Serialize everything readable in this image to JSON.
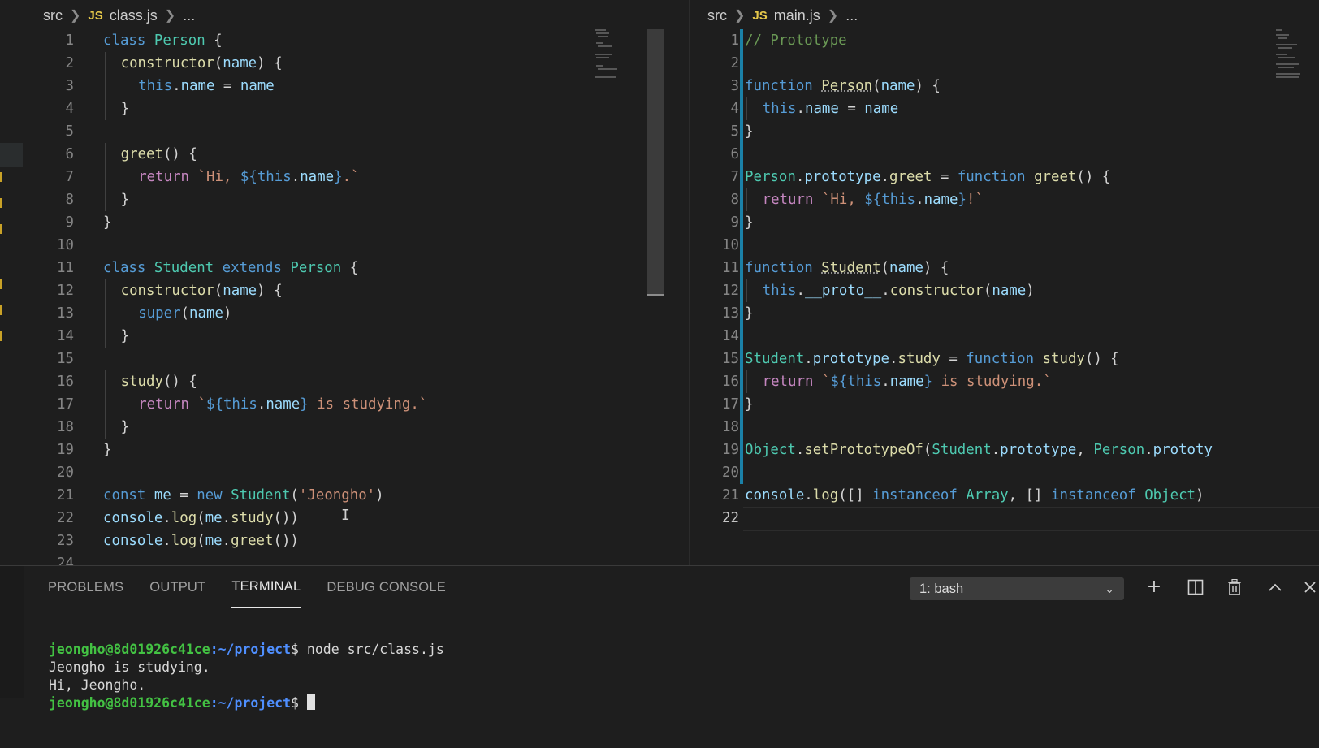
{
  "left_editor": {
    "breadcrumb": {
      "folder": "src",
      "lang_badge": "JS",
      "file": "class.js",
      "rest": "..."
    },
    "lines": [
      {
        "n": "1",
        "tokens": [
          [
            "k",
            "class"
          ],
          [
            "p",
            " "
          ],
          [
            "t",
            "Person"
          ],
          [
            "p",
            " {"
          ]
        ]
      },
      {
        "n": "2",
        "indent": 1,
        "tokens": [
          [
            "f",
            "constructor"
          ],
          [
            "p",
            "("
          ],
          [
            "v",
            "name"
          ],
          [
            "p",
            ") {"
          ]
        ]
      },
      {
        "n": "3",
        "indent": 2,
        "tokens": [
          [
            "k",
            "this"
          ],
          [
            "p",
            "."
          ],
          [
            "v",
            "name"
          ],
          [
            "p",
            " = "
          ],
          [
            "v",
            "name"
          ]
        ]
      },
      {
        "n": "4",
        "indent": 1,
        "tokens": [
          [
            "p",
            "}"
          ]
        ]
      },
      {
        "n": "5",
        "tokens": []
      },
      {
        "n": "6",
        "indent": 1,
        "tokens": [
          [
            "f",
            "greet"
          ],
          [
            "p",
            "() {"
          ]
        ]
      },
      {
        "n": "7",
        "indent": 2,
        "tokens": [
          [
            "kc",
            "return"
          ],
          [
            "p",
            " "
          ],
          [
            "s",
            "`Hi, "
          ],
          [
            "k",
            "${"
          ],
          [
            "k",
            "this"
          ],
          [
            "p",
            "."
          ],
          [
            "v",
            "name"
          ],
          [
            "k",
            "}"
          ],
          [
            "s",
            ".`"
          ]
        ]
      },
      {
        "n": "8",
        "indent": 1,
        "tokens": [
          [
            "p",
            "}"
          ]
        ]
      },
      {
        "n": "9",
        "tokens": [
          [
            "p",
            "}"
          ]
        ]
      },
      {
        "n": "10",
        "tokens": []
      },
      {
        "n": "11",
        "tokens": [
          [
            "k",
            "class"
          ],
          [
            "p",
            " "
          ],
          [
            "t",
            "Student"
          ],
          [
            "p",
            " "
          ],
          [
            "k",
            "extends"
          ],
          [
            "p",
            " "
          ],
          [
            "t",
            "Person"
          ],
          [
            "p",
            " {"
          ]
        ]
      },
      {
        "n": "12",
        "indent": 1,
        "tokens": [
          [
            "f",
            "constructor"
          ],
          [
            "p",
            "("
          ],
          [
            "v",
            "name"
          ],
          [
            "p",
            ") {"
          ]
        ]
      },
      {
        "n": "13",
        "indent": 2,
        "tokens": [
          [
            "k",
            "super"
          ],
          [
            "p",
            "("
          ],
          [
            "v",
            "name"
          ],
          [
            "p",
            ")"
          ]
        ]
      },
      {
        "n": "14",
        "indent": 1,
        "tokens": [
          [
            "p",
            "}"
          ]
        ]
      },
      {
        "n": "15",
        "tokens": []
      },
      {
        "n": "16",
        "indent": 1,
        "tokens": [
          [
            "f",
            "study"
          ],
          [
            "p",
            "() {"
          ]
        ]
      },
      {
        "n": "17",
        "indent": 2,
        "tokens": [
          [
            "kc",
            "return"
          ],
          [
            "p",
            " "
          ],
          [
            "s",
            "`"
          ],
          [
            "k",
            "${"
          ],
          [
            "k",
            "this"
          ],
          [
            "p",
            "."
          ],
          [
            "v",
            "name"
          ],
          [
            "k",
            "}"
          ],
          [
            "s",
            " is studying.`"
          ]
        ]
      },
      {
        "n": "18",
        "indent": 1,
        "tokens": [
          [
            "p",
            "}"
          ]
        ]
      },
      {
        "n": "19",
        "tokens": [
          [
            "p",
            "}"
          ]
        ]
      },
      {
        "n": "20",
        "tokens": []
      },
      {
        "n": "21",
        "tokens": [
          [
            "k",
            "const"
          ],
          [
            "p",
            " "
          ],
          [
            "v",
            "me"
          ],
          [
            "p",
            " = "
          ],
          [
            "k",
            "new"
          ],
          [
            "p",
            " "
          ],
          [
            "t",
            "Student"
          ],
          [
            "p",
            "("
          ],
          [
            "s",
            "'Jeongho'"
          ],
          [
            "p",
            ")"
          ]
        ]
      },
      {
        "n": "22",
        "tokens": [
          [
            "v",
            "console"
          ],
          [
            "p",
            "."
          ],
          [
            "f",
            "log"
          ],
          [
            "p",
            "("
          ],
          [
            "v",
            "me"
          ],
          [
            "p",
            "."
          ],
          [
            "f",
            "study"
          ],
          [
            "p",
            "())"
          ]
        ]
      },
      {
        "n": "23",
        "tokens": [
          [
            "v",
            "console"
          ],
          [
            "p",
            "."
          ],
          [
            "f",
            "log"
          ],
          [
            "p",
            "("
          ],
          [
            "v",
            "me"
          ],
          [
            "p",
            "."
          ],
          [
            "f",
            "greet"
          ],
          [
            "p",
            "())"
          ]
        ]
      },
      {
        "n": "24",
        "tokens": []
      }
    ]
  },
  "right_editor": {
    "breadcrumb": {
      "folder": "src",
      "lang_badge": "JS",
      "file": "main.js",
      "rest": "..."
    },
    "lines": [
      {
        "n": "1",
        "tokens": [
          [
            "c",
            "// Prototype"
          ]
        ]
      },
      {
        "n": "2",
        "tokens": []
      },
      {
        "n": "3",
        "tokens": [
          [
            "k",
            "function"
          ],
          [
            "p",
            " "
          ],
          [
            "fd",
            "Person"
          ],
          [
            "p",
            "("
          ],
          [
            "v",
            "name"
          ],
          [
            "p",
            ") {"
          ]
        ]
      },
      {
        "n": "4",
        "indent": 1,
        "tokens": [
          [
            "k",
            "this"
          ],
          [
            "p",
            "."
          ],
          [
            "v",
            "name"
          ],
          [
            "p",
            " = "
          ],
          [
            "v",
            "name"
          ]
        ]
      },
      {
        "n": "5",
        "tokens": [
          [
            "p",
            "}"
          ]
        ]
      },
      {
        "n": "6",
        "tokens": []
      },
      {
        "n": "7",
        "tokens": [
          [
            "t",
            "Person"
          ],
          [
            "p",
            "."
          ],
          [
            "v",
            "prototype"
          ],
          [
            "p",
            "."
          ],
          [
            "f",
            "greet"
          ],
          [
            "p",
            " = "
          ],
          [
            "k",
            "function"
          ],
          [
            "p",
            " "
          ],
          [
            "f",
            "greet"
          ],
          [
            "p",
            "() {"
          ]
        ]
      },
      {
        "n": "8",
        "indent": 1,
        "tokens": [
          [
            "kc",
            "return"
          ],
          [
            "p",
            " "
          ],
          [
            "s",
            "`Hi, "
          ],
          [
            "k",
            "${"
          ],
          [
            "k",
            "this"
          ],
          [
            "p",
            "."
          ],
          [
            "v",
            "name"
          ],
          [
            "k",
            "}"
          ],
          [
            "s",
            "!`"
          ]
        ]
      },
      {
        "n": "9",
        "tokens": [
          [
            "p",
            "}"
          ]
        ]
      },
      {
        "n": "10",
        "tokens": []
      },
      {
        "n": "11",
        "tokens": [
          [
            "k",
            "function"
          ],
          [
            "p",
            " "
          ],
          [
            "fd",
            "Student"
          ],
          [
            "p",
            "("
          ],
          [
            "v",
            "name"
          ],
          [
            "p",
            ") {"
          ]
        ]
      },
      {
        "n": "12",
        "indent": 1,
        "tokens": [
          [
            "k",
            "this"
          ],
          [
            "p",
            "."
          ],
          [
            "v",
            "__proto__"
          ],
          [
            "p",
            "."
          ],
          [
            "f",
            "constructor"
          ],
          [
            "p",
            "("
          ],
          [
            "v",
            "name"
          ],
          [
            "p",
            ")"
          ]
        ]
      },
      {
        "n": "13",
        "tokens": [
          [
            "p",
            "}"
          ]
        ]
      },
      {
        "n": "14",
        "tokens": []
      },
      {
        "n": "15",
        "tokens": [
          [
            "t",
            "Student"
          ],
          [
            "p",
            "."
          ],
          [
            "v",
            "prototype"
          ],
          [
            "p",
            "."
          ],
          [
            "f",
            "study"
          ],
          [
            "p",
            " = "
          ],
          [
            "k",
            "function"
          ],
          [
            "p",
            " "
          ],
          [
            "f",
            "study"
          ],
          [
            "p",
            "() {"
          ]
        ]
      },
      {
        "n": "16",
        "indent": 1,
        "tokens": [
          [
            "kc",
            "return"
          ],
          [
            "p",
            " "
          ],
          [
            "s",
            "`"
          ],
          [
            "k",
            "${"
          ],
          [
            "k",
            "this"
          ],
          [
            "p",
            "."
          ],
          [
            "v",
            "name"
          ],
          [
            "k",
            "}"
          ],
          [
            "s",
            " is studying.`"
          ]
        ]
      },
      {
        "n": "17",
        "tokens": [
          [
            "p",
            "}"
          ]
        ]
      },
      {
        "n": "18",
        "tokens": []
      },
      {
        "n": "19",
        "tokens": [
          [
            "t",
            "Object"
          ],
          [
            "p",
            "."
          ],
          [
            "f",
            "setPrototypeOf"
          ],
          [
            "p",
            "("
          ],
          [
            "t",
            "Student"
          ],
          [
            "p",
            "."
          ],
          [
            "v",
            "prototype"
          ],
          [
            "p",
            ", "
          ],
          [
            "t",
            "Person"
          ],
          [
            "p",
            "."
          ],
          [
            "v",
            "prototy"
          ]
        ]
      },
      {
        "n": "20",
        "tokens": []
      },
      {
        "n": "21",
        "tokens": [
          [
            "v",
            "console"
          ],
          [
            "p",
            "."
          ],
          [
            "f",
            "log"
          ],
          [
            "p",
            "([] "
          ],
          [
            "k",
            "instanceof"
          ],
          [
            "p",
            " "
          ],
          [
            "t",
            "Array"
          ],
          [
            "p",
            ", [] "
          ],
          [
            "k",
            "instanceof"
          ],
          [
            "p",
            " "
          ],
          [
            "t",
            "Object"
          ],
          [
            "p",
            ")"
          ]
        ]
      },
      {
        "n": "22",
        "tokens": []
      }
    ]
  },
  "panel": {
    "tabs": [
      "PROBLEMS",
      "OUTPUT",
      "TERMINAL",
      "DEBUG CONSOLE"
    ],
    "active_tab": "TERMINAL",
    "shell_select": "1: bash",
    "terminal": {
      "prompt_user": "jeongho@8d01926c41ce",
      "prompt_path": ":~/project",
      "prompt_symbol": "$",
      "command": " node src/class.js",
      "output": [
        "Jeongho is studying.",
        "Hi, Jeongho."
      ]
    }
  },
  "colors": {
    "background": "#1e1e1e",
    "keyword": "#569cd6",
    "string": "#ce9178",
    "function": "#dcdcaa",
    "comment": "#6a9955"
  }
}
